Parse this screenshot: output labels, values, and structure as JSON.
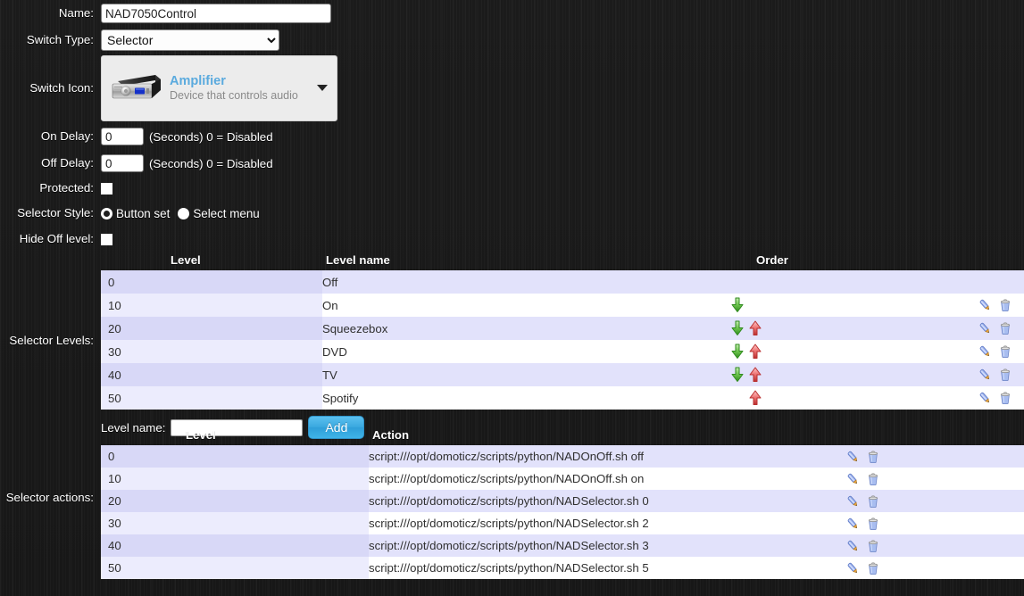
{
  "form": {
    "name": {
      "label": "Name:",
      "value": "NAD7050Control"
    },
    "switch_type": {
      "label": "Switch Type:",
      "value": "Selector",
      "options": [
        "Selector"
      ]
    },
    "switch_icon": {
      "label": "Switch Icon:",
      "title": "Amplifier",
      "subtitle": "Device that controls audio",
      "icon": "amplifier-icon",
      "caret": "chevron-down-icon"
    },
    "on_delay": {
      "label": "On Delay:",
      "value": "0",
      "hint": "(Seconds) 0 = Disabled"
    },
    "off_delay": {
      "label": "Off Delay:",
      "value": "0",
      "hint": "(Seconds) 0 = Disabled"
    },
    "protected": {
      "label": "Protected:",
      "checked": false
    },
    "selector_style": {
      "label": "Selector Style:",
      "options": [
        {
          "label": "Button set",
          "selected": true
        },
        {
          "label": "Select menu",
          "selected": false
        }
      ]
    },
    "hide_off_level": {
      "label": "Hide Off level:",
      "checked": false
    },
    "selector_levels": {
      "label": "Selector Levels:",
      "columns": [
        "Level",
        "Level name",
        "Order"
      ],
      "rows": [
        {
          "level": "0",
          "name": "Off",
          "down": false,
          "up": false
        },
        {
          "level": "10",
          "name": "On",
          "down": true,
          "up": false
        },
        {
          "level": "20",
          "name": "Squeezebox",
          "down": true,
          "up": true
        },
        {
          "level": "30",
          "name": "DVD",
          "down": true,
          "up": true
        },
        {
          "level": "40",
          "name": "TV",
          "down": true,
          "up": true
        },
        {
          "level": "50",
          "name": "Spotify",
          "down": false,
          "up": true
        }
      ],
      "tools": {
        "edit": "pencil-icon",
        "delete": "trash-icon"
      },
      "add_row": {
        "label": "Level name:",
        "value": "",
        "placeholder": "",
        "button": "Add"
      }
    },
    "selector_actions": {
      "label": "Selector actions:",
      "columns": [
        "Level",
        "Action"
      ],
      "rows": [
        {
          "level": "0",
          "action": "script:///opt/domoticz/scripts/python/NADOnOff.sh off"
        },
        {
          "level": "10",
          "action": "script:///opt/domoticz/scripts/python/NADOnOff.sh on"
        },
        {
          "level": "20",
          "action": "script:///opt/domoticz/scripts/python/NADSelector.sh 0"
        },
        {
          "level": "30",
          "action": "script:///opt/domoticz/scripts/python/NADSelector.sh 2"
        },
        {
          "level": "40",
          "action": "script:///opt/domoticz/scripts/python/NADSelector.sh 3"
        },
        {
          "level": "50",
          "action": "script:///opt/domoticz/scripts/python/NADSelector.sh 5"
        }
      ],
      "tools": {
        "edit": "pencil-icon",
        "delete": "trash-icon"
      }
    }
  },
  "colors": {
    "background": "#1b1b1b",
    "row_odd": "#e2e2fb",
    "row_even": "#ffffff",
    "level_cell_odd": "#d8d8f7",
    "level_cell_even": "#ececeefd",
    "accent_link": "#5aaade",
    "button_blue": "#3aa9e0",
    "arrow_down": "#4aad3a",
    "arrow_up": "#e05050"
  }
}
